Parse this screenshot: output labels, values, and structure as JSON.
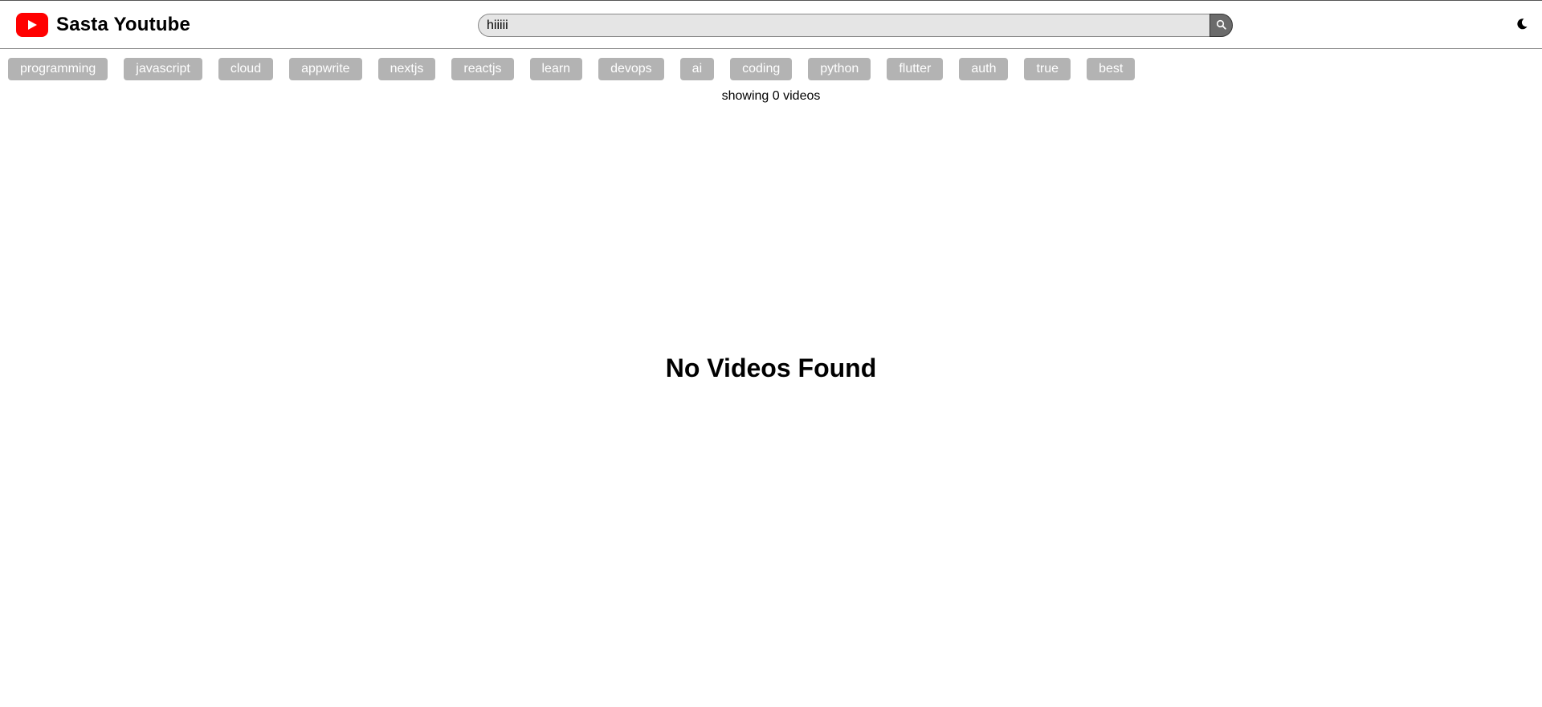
{
  "header": {
    "title": "Sasta Youtube",
    "logo_icon": "youtube-play-icon",
    "brand_color": "#ff0000"
  },
  "search": {
    "value": "hiiiii",
    "button_icon": "search-icon"
  },
  "theme_toggle": {
    "icon": "moon-icon"
  },
  "tags": [
    {
      "label": "programming"
    },
    {
      "label": "javascript"
    },
    {
      "label": "cloud"
    },
    {
      "label": "appwrite"
    },
    {
      "label": "nextjs"
    },
    {
      "label": "reactjs"
    },
    {
      "label": "learn"
    },
    {
      "label": "devops"
    },
    {
      "label": "ai"
    },
    {
      "label": "coding"
    },
    {
      "label": "python"
    },
    {
      "label": "flutter"
    },
    {
      "label": "auth"
    },
    {
      "label": "true"
    },
    {
      "label": "best"
    }
  ],
  "results": {
    "count_text": "showing 0 videos",
    "empty_text": "No Videos Found"
  }
}
